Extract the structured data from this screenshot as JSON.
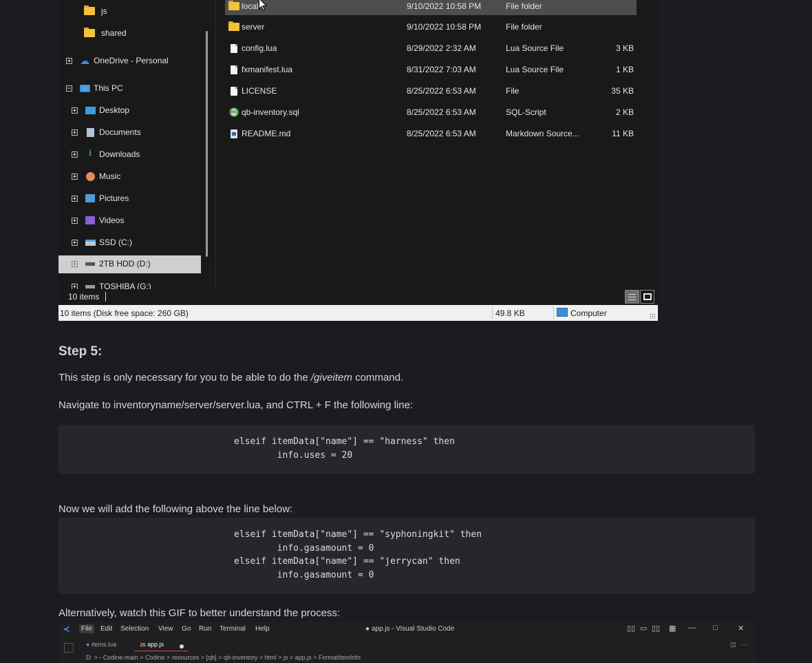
{
  "explorer": {
    "nav_items": [
      {
        "label": "js",
        "icon": "folder-icon",
        "expander": ""
      },
      {
        "label": "shared",
        "icon": "folder-icon",
        "expander": ""
      },
      {
        "label": "OneDrive - Personal",
        "icon": "onedrive-cloud-icon",
        "expander": "+"
      },
      {
        "label": "This PC",
        "icon": "this-pc-icon",
        "expander": "−"
      },
      {
        "label": "Desktop",
        "icon": "desktop-icon",
        "expander": "+"
      },
      {
        "label": "Documents",
        "icon": "documents-icon",
        "expander": "+"
      },
      {
        "label": "Downloads",
        "icon": "downloads-icon",
        "expander": "+"
      },
      {
        "label": "Music",
        "icon": "music-icon",
        "expander": "+"
      },
      {
        "label": "Pictures",
        "icon": "pictures-icon",
        "expander": "+"
      },
      {
        "label": "Videos",
        "icon": "videos-icon",
        "expander": "+"
      },
      {
        "label": "SSD (C:)",
        "icon": "drive-c-icon",
        "expander": "+"
      },
      {
        "label": "2TB HDD (D:)",
        "icon": "drive-d-icon",
        "expander": "+"
      },
      {
        "label": "TOSHIBA (G:)",
        "icon": "drive-g-icon",
        "expander": "+"
      }
    ],
    "files": [
      {
        "name": "local",
        "date": "9/10/2022 10:58 PM",
        "type": "File folder",
        "size": "",
        "icon": "folder-icon"
      },
      {
        "name": "server",
        "date": "9/10/2022 10:58 PM",
        "type": "File folder",
        "size": "",
        "icon": "folder-icon"
      },
      {
        "name": "config.lua",
        "date": "8/29/2022 2:32 AM",
        "type": "Lua Source File",
        "size": "3 KB",
        "icon": "lua-file-icon"
      },
      {
        "name": "fxmanifest.lua",
        "date": "8/31/2022 7:03 AM",
        "type": "Lua Source File",
        "size": "1 KB",
        "icon": "lua-file-icon"
      },
      {
        "name": "LICENSE",
        "date": "8/25/2022 6:53 AM",
        "type": "File",
        "size": "35 KB",
        "icon": "file-icon"
      },
      {
        "name": "qb-inventory.sql",
        "date": "8/25/2022 6:53 AM",
        "type": "SQL-Script",
        "size": "2 KB",
        "icon": "sql-file-icon"
      },
      {
        "name": "README.md",
        "date": "8/25/2022 6:53 AM",
        "type": "Markdown Source...",
        "size": "11 KB",
        "icon": "markdown-file-icon"
      }
    ],
    "status_count": "10 items",
    "status_bar": {
      "summary": "10 items (Disk free space: 260 GB)",
      "size": "49.8 KB",
      "location": "Computer"
    }
  },
  "article": {
    "heading": "Step 5:",
    "p1_before": "This step is only necessary for you to be able to do the ",
    "p1_em": "/giveitem",
    "p1_after": " command.",
    "p2": "Navigate to inventoryname/server/server.lua, and CTRL + F the following line:",
    "code1": [
      "elseif itemData[\"name\"] == \"harness\" then",
      "        info.uses = 20"
    ],
    "p3": "Now we will add the following above the line below:",
    "code2": [
      "elseif itemData[\"name\"] == \"syphoningkit\" then",
      "        info.gasamount = 0",
      "elseif itemData[\"name\"] == \"jerrycan\" then",
      "        info.gasamount = 0"
    ],
    "p4": "Alternatively, watch this GIF to better understand the process:"
  },
  "vscode": {
    "menu": [
      "File",
      "Edit",
      "Selection",
      "View",
      "Go",
      "Run",
      "Terminal",
      "Help"
    ],
    "window_title": "● app.js - Visual Studio Code",
    "tabs": [
      "items.lua",
      "app.js"
    ],
    "breadcrumbs": "D: > - Codine-main > Codine > resources > [qb] > qb-inventory > html > js > app.js > FormatItemInfo"
  },
  "colors": {
    "page_bg": "#1b1c21",
    "code_bg": "#25272c",
    "folder": "#f4c13d"
  }
}
